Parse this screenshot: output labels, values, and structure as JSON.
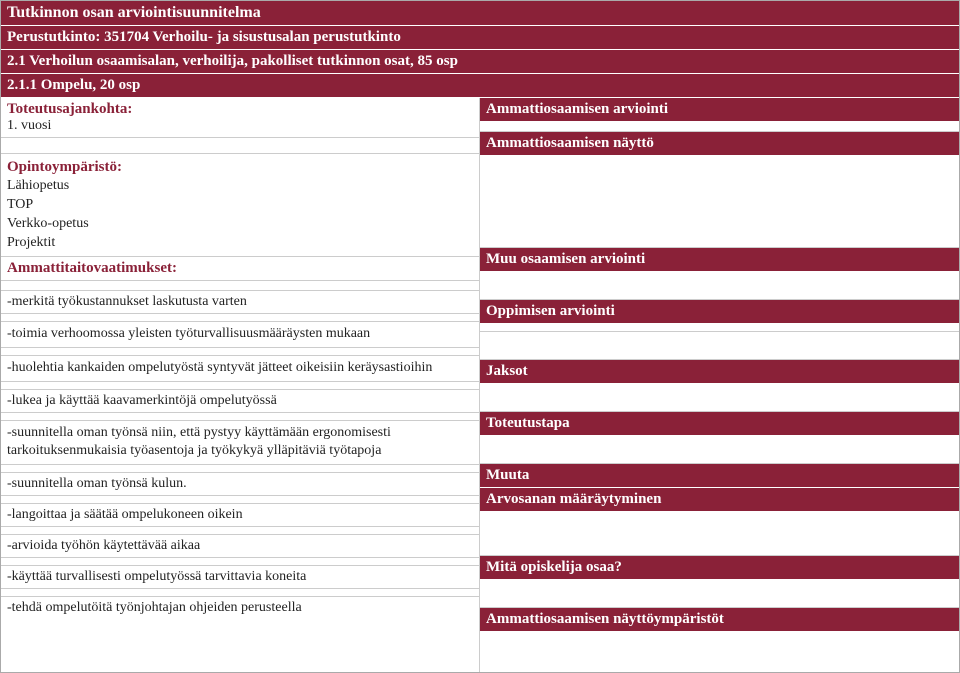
{
  "header": {
    "title": "Tutkinnon osan arviointisuunnitelma",
    "sub": "Perustutkinto: 351704 Verhoilu- ja sisustusalan perustutkinto",
    "section": "2.1 Verhoilun osaamisalan, verhoilija, pakolliset tutkinnon osat, 85 osp",
    "unit": "2.1.1 Ompelu, 20 osp"
  },
  "left": {
    "timing_label": "Toteutusajankohta:",
    "timing_value": "1. vuosi",
    "env_label": "Opintoympäristö:",
    "env_lines": [
      "Lähiopetus",
      "TOP",
      "Verkko-opetus",
      "Projektit"
    ],
    "skills_label": "Ammattitaitovaatimukset:",
    "items": [
      "-merkitä työkustannukset laskutusta varten",
      "-toimia verhoomossa yleisten työturvallisuusmääräysten mukaan",
      "-huolehtia kankaiden ompelutyöstä syntyvät jätteet oikeisiin keräysastioihin",
      "-lukea ja käyttää kaavamerkintöjä ompelutyössä",
      "-suunnitella oman työnsä niin, että pystyy käyttämään ergonomisesti tarkoituksenmukaisia työasentoja ja työkykyä ylläpitäviä työtapoja",
      "-suunnitella oman työnsä kulun.",
      "-langoittaa ja säätää ompelukoneen oikein",
      "-arvioida työhön käytettävää aikaa",
      "-käyttää turvallisesti ompelutyössä tarvittavia koneita",
      "-tehdä ompelutöitä työnjohtajan ohjeiden perusteella"
    ]
  },
  "right": {
    "r1": "Ammattiosaamisen arviointi",
    "r2": "Ammattiosaamisen näyttö",
    "r3": "Muu osaamisen arviointi",
    "r4": "Oppimisen arviointi",
    "r5": "Jaksot",
    "r6": "Toteutustapa",
    "r7": "Muuta",
    "r8": "Arvosanan määräytyminen",
    "r9": "Mitä opiskelija osaa?",
    "r10": "Ammattiosaamisen näyttöympäristöt"
  }
}
